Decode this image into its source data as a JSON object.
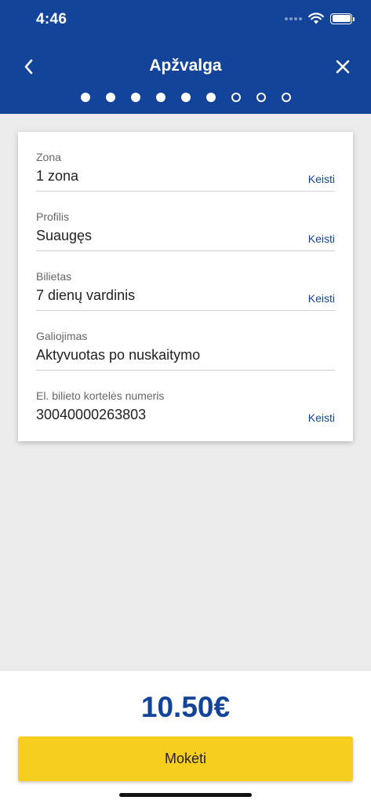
{
  "status_bar": {
    "time": "4:46"
  },
  "nav": {
    "title": "Apžvalga"
  },
  "steps": {
    "total": 9,
    "completed": 6
  },
  "details": [
    {
      "label": "Zona",
      "value": "1 zona",
      "change": "Keisti"
    },
    {
      "label": "Profilis",
      "value": "Suaugęs",
      "change": "Keisti"
    },
    {
      "label": "Bilietas",
      "value": "7 dienų vardinis",
      "change": "Keisti"
    },
    {
      "label": "Galiojimas",
      "value": "Aktyvuotas po nuskaitymo",
      "change": ""
    },
    {
      "label": "El. bilieto kortelės numeris",
      "value": "30040000263803",
      "change": "Keisti"
    }
  ],
  "footer": {
    "price": "10.50€",
    "pay_label": "Mokėti"
  },
  "colors": {
    "primary": "#144499",
    "accent": "#f7cd1e",
    "background": "#ebebeb"
  },
  "icons": {
    "back": "chevron-left-icon",
    "close": "close-icon",
    "wifi": "wifi-icon",
    "battery": "battery-icon"
  }
}
